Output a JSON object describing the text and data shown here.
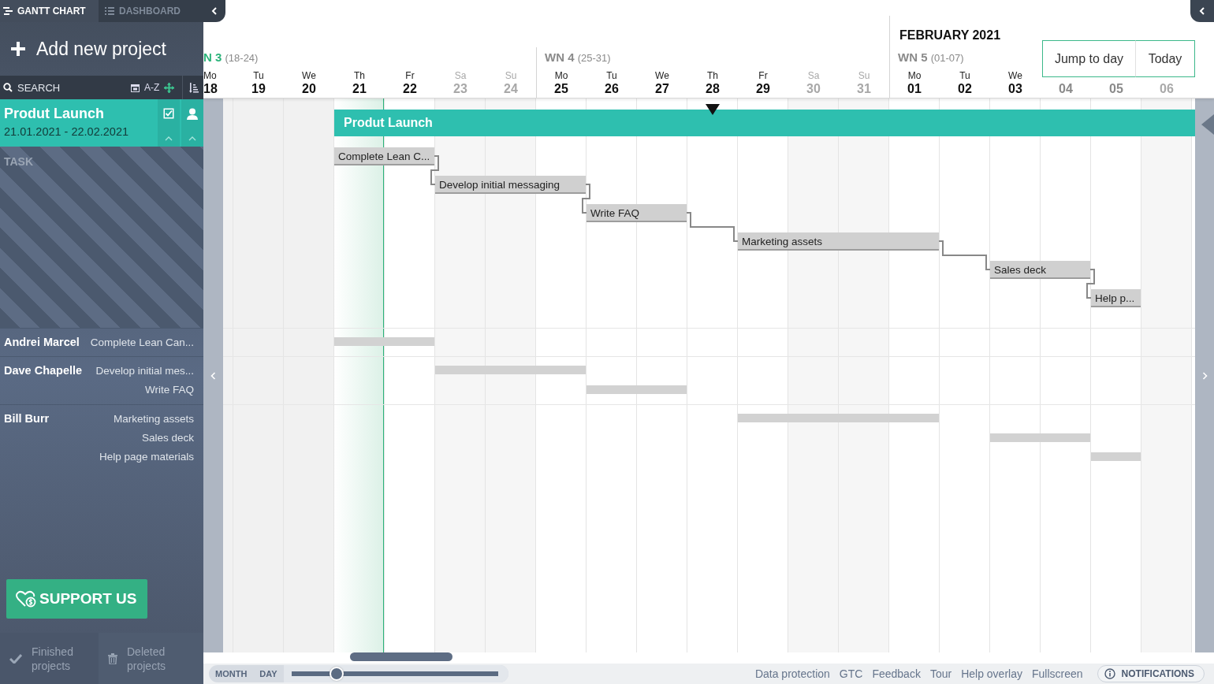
{
  "tabs": [
    {
      "label": "GANTT CHART",
      "selected": true
    },
    {
      "label": "DASHBOARD",
      "selected": false
    }
  ],
  "add_project": "Add new project",
  "search": {
    "placeholder": "SEARCH"
  },
  "sort_label": "A-Z",
  "project": {
    "name": "Produt Launch",
    "dates": "21.01.2021 - 22.02.2021",
    "selected": true
  },
  "task_header": "TASK",
  "resources": [
    {
      "name": "Andrei Marcel",
      "tasks": [
        "Complete Lean Can..."
      ]
    },
    {
      "name": "Dave Chapelle",
      "tasks": [
        "Develop initial mes...",
        "Write FAQ"
      ]
    },
    {
      "name": "Bill Burr",
      "tasks": [
        "Marketing assets",
        "Sales deck",
        "Help page materials"
      ]
    }
  ],
  "support_button": "SUPPORT US",
  "bottom_tabs": [
    {
      "label": "Finished projects",
      "kind": "finished"
    },
    {
      "label": "Deleted projects",
      "kind": "deleted"
    }
  ],
  "month_label": "FEBRUARY 2021",
  "weeks": [
    {
      "label": "N 3",
      "range": "(18-24)",
      "current": true
    },
    {
      "label": "WN 4",
      "range": "(25-31)",
      "current": false
    },
    {
      "label": "WN 5",
      "range": "(01-07)",
      "current": false
    }
  ],
  "days": [
    {
      "name": "Mo",
      "number": "18",
      "kind": "past"
    },
    {
      "name": "Tu",
      "number": "19",
      "kind": "past"
    },
    {
      "name": "We",
      "number": "20",
      "kind": "past"
    },
    {
      "name": "Th",
      "number": "21",
      "kind": "today"
    },
    {
      "name": "Fr",
      "number": "22",
      "kind": "workday"
    },
    {
      "name": "Sa",
      "number": "23",
      "kind": "weekend"
    },
    {
      "name": "Su",
      "number": "24",
      "kind": "weekend"
    },
    {
      "name": "Mo",
      "number": "25",
      "kind": "workday"
    },
    {
      "name": "Tu",
      "number": "26",
      "kind": "workday"
    },
    {
      "name": "We",
      "number": "27",
      "kind": "workday"
    },
    {
      "name": "Th",
      "number": "28",
      "kind": "workday"
    },
    {
      "name": "Fr",
      "number": "29",
      "kind": "workday"
    },
    {
      "name": "Sa",
      "number": "30",
      "kind": "weekend"
    },
    {
      "name": "Su",
      "number": "31",
      "kind": "weekend"
    },
    {
      "name": "Mo",
      "number": "01",
      "kind": "workday"
    },
    {
      "name": "Tu",
      "number": "02",
      "kind": "workday"
    },
    {
      "name": "We",
      "number": "03",
      "kind": "workday"
    },
    {
      "number": "04",
      "kind": "faded"
    },
    {
      "number": "05",
      "kind": "faded"
    },
    {
      "number": "06",
      "kind": "faded-weekend"
    }
  ],
  "header_buttons": [
    "Jump to day",
    "Today"
  ],
  "project_bar": "Produt Launch",
  "tasks": [
    "Complete Lean C...",
    "Develop initial messaging",
    "Write FAQ",
    "Marketing assets",
    "Sales deck",
    "Help p..."
  ],
  "zoom": {
    "labels": [
      "MONTH",
      "DAY"
    ],
    "level": 0.22
  },
  "footer_links": [
    "Data protection",
    "GTC",
    "Feedback",
    "Tour",
    "Help overlay",
    "Fullscreen"
  ],
  "notifications_button": "NOTIFICATIONS"
}
